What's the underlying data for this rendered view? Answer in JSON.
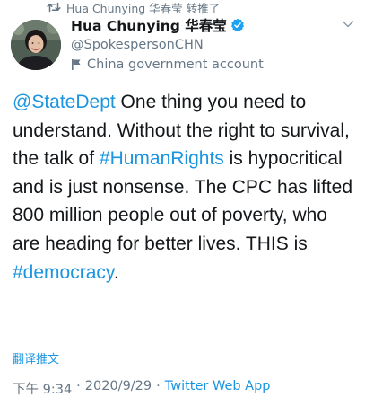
{
  "retweet": {
    "icon": "retweet-icon",
    "text": "Hua Chunying 华春莹 转推了"
  },
  "author": {
    "name": "Hua Chunying 华春莹",
    "verified": true,
    "handle": "@SpokespersonCHN",
    "label": "China government account",
    "label_icon": "flag-icon"
  },
  "tweet": {
    "mention": "@StateDept",
    "text_1": " One thing you need to understand. Without the right to survival, the talk of ",
    "hashtag_1": "#HumanRights",
    "text_2": " is hypocritical and is just nonsense. The CPC has lifted 800 million people out of poverty, who are heading for better lives. THIS is ",
    "hashtag_2": "#democracy",
    "text_3": "."
  },
  "translate_label": "翻译推文",
  "meta": {
    "time": "下午 9:34",
    "separator_1": "·",
    "date": "2020/9/29",
    "separator_2": "·",
    "source": "Twitter Web App"
  },
  "colors": {
    "link": "#1b95e0",
    "secondary_text": "#657786",
    "primary_text": "#14171a",
    "verified_badge": "#1da1f2"
  }
}
